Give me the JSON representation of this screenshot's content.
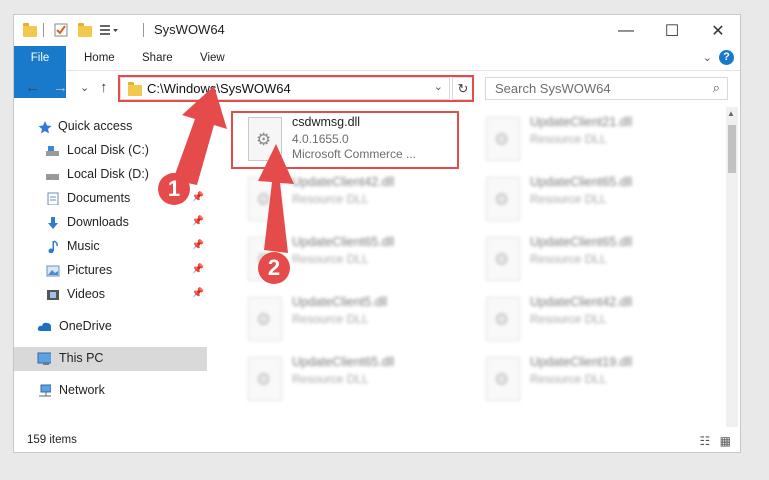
{
  "window": {
    "title": "SysWOW64",
    "minimize_glyph": "—",
    "maximize_glyph": "☐",
    "close_glyph": "✕"
  },
  "ribbon": {
    "tabs": [
      "File",
      "Home",
      "Share",
      "View"
    ],
    "help_glyph": "?",
    "expand_glyph": "⌄"
  },
  "navbar": {
    "back_glyph": "←",
    "forward_glyph": "→",
    "recent_glyph": "⌄",
    "up_glyph": "↑",
    "address": "C:\\Windows\\SysWOW64",
    "address_drop_glyph": "⌄",
    "refresh_glyph": "↻",
    "search_placeholder": "Search SysWOW64",
    "search_icon_glyph": "⌕"
  },
  "sidebar": {
    "items": [
      {
        "label": "Quick access",
        "icon": "star-icon"
      },
      {
        "label": "Local Disk (C:)",
        "icon": "drive-icon"
      },
      {
        "label": "Local Disk (D:)",
        "icon": "drive-icon"
      },
      {
        "label": "Documents",
        "icon": "documents-icon"
      },
      {
        "label": "Downloads",
        "icon": "download-icon"
      },
      {
        "label": "Music",
        "icon": "music-icon"
      },
      {
        "label": "Pictures",
        "icon": "pictures-icon"
      },
      {
        "label": "Videos",
        "icon": "videos-icon"
      },
      {
        "label": "OneDrive",
        "icon": "cloud-icon"
      },
      {
        "label": "This PC",
        "icon": "computer-icon"
      },
      {
        "label": "Network",
        "icon": "network-icon"
      }
    ],
    "pin_glyph": "📌"
  },
  "files": {
    "highlighted": {
      "name": "csdwmsg.dll",
      "version": "4.0.1655.0",
      "description": "Microsoft Commerce ..."
    },
    "blurred": [
      {
        "name": "UpdateClient21.dll",
        "type": "Resource DLL"
      },
      {
        "name": "UpdateClient42.dll",
        "type": "Resource DLL"
      },
      {
        "name": "UpdateClient65.dll",
        "type": "Resource DLL"
      },
      {
        "name": "UpdateClient65.dll",
        "type": "Resource DLL"
      },
      {
        "name": "UpdateClient65.dll",
        "type": "Resource DLL"
      },
      {
        "name": "UpdateClient5.dll",
        "type": "Resource DLL"
      },
      {
        "name": "UpdateClient42.dll",
        "type": "Resource DLL"
      },
      {
        "name": "UpdateClient65.dll",
        "type": "Resource DLL"
      },
      {
        "name": "UpdateClient19.dll",
        "type": "Resource DLL"
      }
    ]
  },
  "status": {
    "item_count": "159 items"
  },
  "annotations": {
    "step1": "1",
    "step2": "2",
    "color": "#e54b4b"
  }
}
